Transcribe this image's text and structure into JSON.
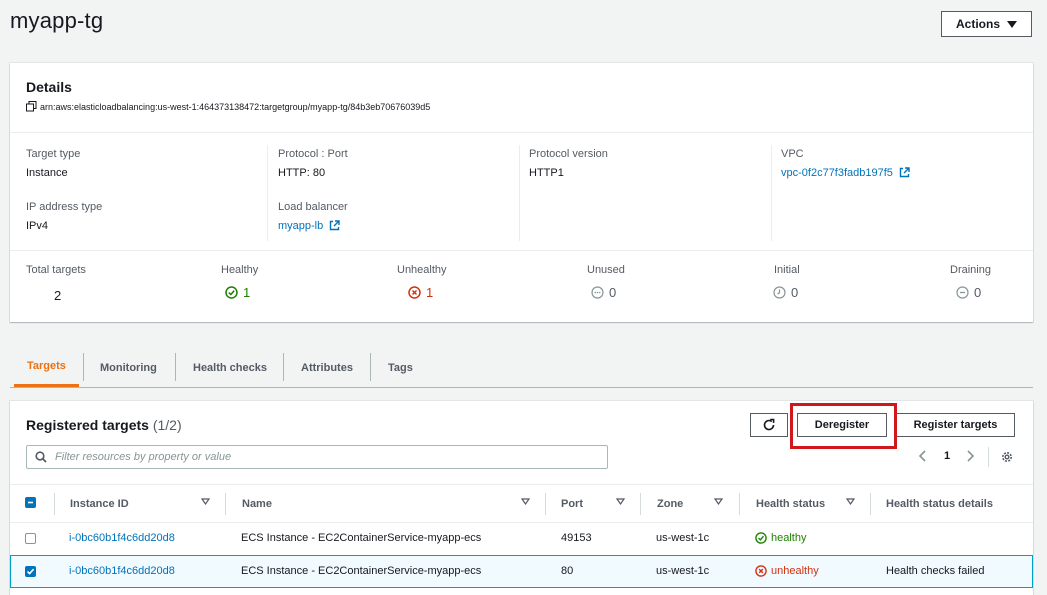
{
  "page": {
    "title": "myapp-tg",
    "actions_label": "Actions"
  },
  "details": {
    "heading": "Details",
    "arn": "arn:aws:elasticloadbalancing:us-west-1:464373138472:targetgroup/myapp-tg/84b3eb70676039d5",
    "target_type_label": "Target type",
    "target_type": "Instance",
    "ip_type_label": "IP address type",
    "ip_type": "IPv4",
    "protocol_port_label": "Protocol : Port",
    "protocol_port": "HTTP: 80",
    "load_balancer_label": "Load balancer",
    "load_balancer": "myapp-lb",
    "protocol_version_label": "Protocol version",
    "protocol_version": "HTTP1",
    "vpc_label": "VPC",
    "vpc": "vpc-0f2c77f3fadb197f5"
  },
  "stats": {
    "total_label": "Total targets",
    "total": "2",
    "healthy_label": "Healthy",
    "healthy": "1",
    "unhealthy_label": "Unhealthy",
    "unhealthy": "1",
    "unused_label": "Unused",
    "unused": "0",
    "initial_label": "Initial",
    "initial": "0",
    "draining_label": "Draining",
    "draining": "0"
  },
  "tabs": [
    "Targets",
    "Monitoring",
    "Health checks",
    "Attributes",
    "Tags"
  ],
  "registered": {
    "heading": "Registered targets",
    "count": "(1/2)",
    "deregister_label": "Deregister",
    "register_label": "Register targets",
    "filter_placeholder": "Filter resources by property or value",
    "page": "1"
  },
  "table": {
    "columns": [
      "Instance ID",
      "Name",
      "Port",
      "Zone",
      "Health status",
      "Health status details"
    ],
    "rows": [
      {
        "id": "i-0bc60b1f4c6dd20d8",
        "name": "ECS Instance - EC2ContainerService-myapp-ecs",
        "port": "49153",
        "zone": "us-west-1c",
        "health": "healthy",
        "details": "",
        "selected": false
      },
      {
        "id": "i-0bc60b1f4c6dd20d8",
        "name": "ECS Instance - EC2ContainerService-myapp-ecs",
        "port": "80",
        "zone": "us-west-1c",
        "health": "unhealthy",
        "details": "Health checks failed",
        "selected": true
      }
    ]
  },
  "colors": {
    "link": "#0073bb",
    "healthy": "#1d8102",
    "unhealthy": "#d13212",
    "tab_active": "#ec7211",
    "highlight": "#d0171c"
  }
}
